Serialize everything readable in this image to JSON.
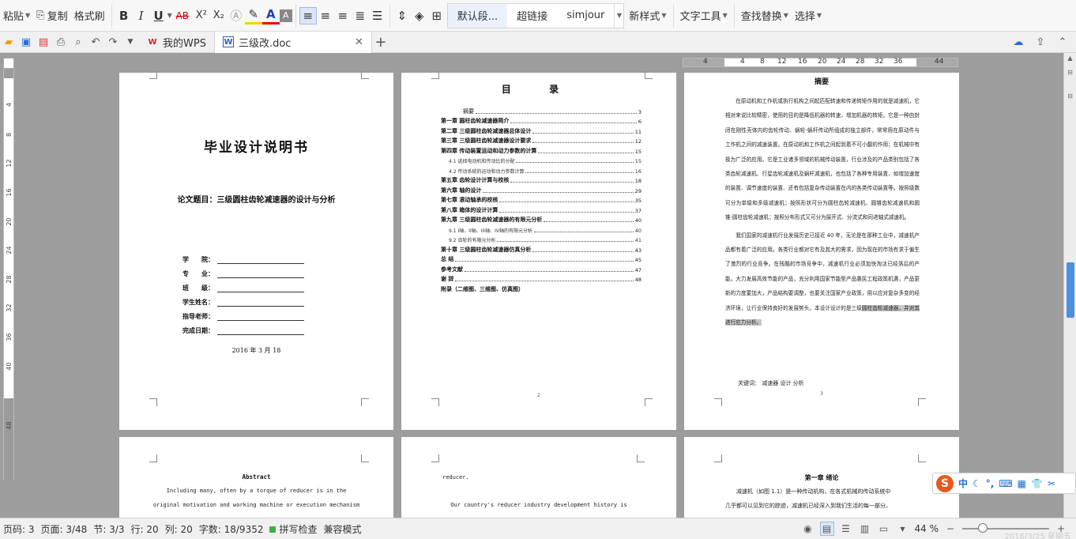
{
  "ribbon": {
    "paste": "粘贴",
    "copy": "复制",
    "format_painter": "格式刷",
    "bold": "B",
    "italic": "I",
    "underline": "U",
    "strikethrough": "AB",
    "superscript": "X²",
    "subscript": "X₂",
    "font_color": "A",
    "styles": [
      "默认段...",
      "超链接",
      "simjour"
    ],
    "new_style": "新样式",
    "text_tools": "文字工具",
    "find_replace": "查找替换",
    "select": "选择"
  },
  "tabs": {
    "wps": "我的WPS",
    "doc": "三级改.doc",
    "add": "+"
  },
  "ruler": {
    "vertical": [
      "4",
      "8",
      "12",
      "16",
      "20",
      "24",
      "28",
      "32",
      "36",
      "40",
      "48"
    ],
    "horizontal": [
      "4",
      "4",
      "8",
      "12",
      "16",
      "20",
      "24",
      "28",
      "32",
      "36",
      "44"
    ]
  },
  "page1": {
    "title": "毕业设计说明书",
    "subtitle": "论文题目：三级圆柱齿轮减速器的设计与分析",
    "fields": [
      "学　　院：",
      "专　　业：",
      "班　　级：",
      "学生姓名：",
      "指导老师：",
      "完成日期："
    ],
    "date": "2016 年 3 月 18"
  },
  "page2": {
    "title": "目 录",
    "entries": [
      {
        "text": "摘要",
        "page": "3",
        "kind": "top"
      },
      {
        "text": "第一章  圆柱齿轮减速器简介",
        "page": "6",
        "kind": "b"
      },
      {
        "text": "第二章  三级圆柱齿轮减速器总体设计",
        "page": "11",
        "kind": "b"
      },
      {
        "text": "第三章  三级圆柱齿轮减速器设计要求",
        "page": "12",
        "kind": "b"
      },
      {
        "text": "第四章  传动装置运动和动力参数的计算",
        "page": "15",
        "kind": "b"
      },
      {
        "text": "4.1 选择电动机和传动比的分配",
        "page": "15",
        "kind": "sub"
      },
      {
        "text": "4.2 传动系统的运动和动力参数计算",
        "page": "16",
        "kind": "sub"
      },
      {
        "text": "第五章  齿轮设计计算与校核",
        "page": "18",
        "kind": "b"
      },
      {
        "text": "第六章  轴的设计",
        "page": "29",
        "kind": "b"
      },
      {
        "text": "第七章  滚动轴承的校核",
        "page": "35",
        "kind": "b"
      },
      {
        "text": "第八章  箱体的设计计算",
        "page": "37",
        "kind": "b"
      },
      {
        "text": "第九章  三级圆柱齿轮减速器的有限元分析",
        "page": "40",
        "kind": "b"
      },
      {
        "text": "9.1  I轴、II轴、III轴、IV轴的有限元分析",
        "page": "40",
        "kind": "sub"
      },
      {
        "text": "9.2  齿轮的有限元分析",
        "page": "41",
        "kind": "sub"
      },
      {
        "text": "第十章  三级圆柱齿轮减速器仿真分析",
        "page": "43",
        "kind": "b"
      },
      {
        "text": "总  结",
        "page": "45",
        "kind": "b"
      },
      {
        "text": "参考文献",
        "page": "47",
        "kind": "b"
      },
      {
        "text": "谢  辞",
        "page": "48",
        "kind": "b"
      },
      {
        "text": "附录（二维图、三维图、仿真图）",
        "page": "",
        "kind": "b"
      }
    ],
    "page_number": "2"
  },
  "page3": {
    "heading": "摘要",
    "para1": "在原动机和工作机或执行机构之间起匹配转速和传递转矩作用的就是减速机，它相对来说比较精密，使用的目的是降低机器的转速，增加机器的转矩。它是一种由封闭在刚性壳体内的齿轮传动、蜗轮-蜗杆传动所组成的独立部件，常常用在原动件与工作机之间的减速装置。在原动机和工作机之间起到着不可小觑的作用；在机械中有极为广泛的应用。它是工业诸多领域的机械传动装置，行业涉及的产品类别包括了各类齿轮减速机、行星齿轮减速机及蜗杆减速机，也包括了各种专用装置，如增加速度的装置、调节速度的装置、还有包括复杂传动装置在内的各类传动装置等。按照级数可分为单级和多级减速机；按照形状可分为圆柱齿轮减速机、圆锥齿轮减速机和圆锥-圆柱齿轮减速机；按照分布形式又可分为展开式、分流式和同进轴式减速机。",
    "para2_main": "我们国家的减速机行业发展历史已接近 40 年，无论是在那种工业中，减速机产品都有着广泛的应用。各类行业都对它有及其大的需求，因为现在的市场有求于偏生了激烈的行业竞争。在残酷的市场竞争中，减速机行业必须加快淘汰已经落后的产能，大力发展高效节能的产品，充分利用国家节能型产品惠民工程政策机遇，产品更新的力度要加大，产品结构要调整，也要关注国家产业政策，用以应对复杂多变的经济环境，让行业保持良好的发展势头。本设计设计的是三级",
    "para2_highlight": "圆柱齿轮减速器，并对其进行应力分析。",
    "keywords": "关键词：  减速器    设计    分析",
    "page_number": "3"
  },
  "page4": {
    "heading": "Abstract",
    "line1": "Including many, often by a torque of reducer is in the",
    "line2": "original motivation and working machine or execution mechanism"
  },
  "page5": {
    "line1": "reducer.",
    "line2": "Our  country's  reducer  industry  development  history  is"
  },
  "page6": {
    "heading": "第一章  绪论",
    "line1": "减速机（如图 1.1）是一种传动机构，在各式机械的传动系统中",
    "line2": "几乎都可以见到它的踪迹，减速机已经深入到我们生活的每一部分。"
  },
  "ime": {
    "logo": "S",
    "mode": "中"
  },
  "status": {
    "page_code": "页码: 3",
    "page": "页面: 3/48",
    "section": "节: 3/3",
    "row": "行: 20",
    "col": "列: 20",
    "words": "字数: 18/9352",
    "spell": "拼写检查",
    "compat": "兼容模式",
    "zoom": "44 %",
    "clock": "2016/3/25 星期五"
  }
}
